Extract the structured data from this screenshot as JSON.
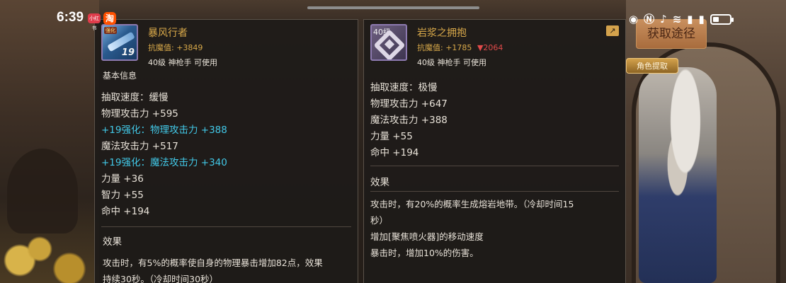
{
  "status_bar": {
    "time": "6:39",
    "badge_small": "小红书",
    "badge_app": "淘",
    "icons": [
      "eye-icon",
      "nfc-icon",
      "mute-icon",
      "wifi-icon",
      "signal-icon",
      "signal-icon-2",
      "battery-icon"
    ]
  },
  "obtain_button": {
    "label": "获取途径"
  },
  "left_item": {
    "name": "暴风行者",
    "icon_level": "19",
    "icon_tag": "强化",
    "magic_resist_label": "抗魔值:",
    "magic_resist_value": "+3849",
    "class_info": "40级 神枪手 可使用",
    "section_title": "基本信息",
    "stats": [
      {
        "text": "抽取速度：缓慢",
        "type": "normal"
      },
      {
        "text": "物理攻击力 +595",
        "type": "normal"
      },
      {
        "text": "+19强化：物理攻击力 +388",
        "type": "enhance"
      },
      {
        "text": "魔法攻击力 +517",
        "type": "normal"
      },
      {
        "text": "+19强化：魔法攻击力 +340",
        "type": "enhance"
      },
      {
        "text": "力量 +36",
        "type": "normal"
      },
      {
        "text": "智力 +55",
        "type": "normal"
      },
      {
        "text": "命中 +194",
        "type": "normal"
      }
    ],
    "effect_title": "效果",
    "effect_lines": [
      "攻击时，有5%的概率使自身的物理暴击增加82点，效果",
      "持续30秒。（冷却时间30秒）"
    ]
  },
  "right_item": {
    "name": "岩浆之拥抱",
    "icon_level": "40级",
    "magic_resist_label": "抗魔值:",
    "magic_resist_value": "+1785",
    "magic_resist_compare": "▼2064",
    "class_info": "40级 神枪手 可使用",
    "share_icon": "share-icon",
    "stats": [
      {
        "text": "抽取速度：极慢",
        "type": "normal"
      },
      {
        "text": "物理攻击力 +647",
        "type": "normal"
      },
      {
        "text": "魔法攻击力 +388",
        "type": "normal"
      },
      {
        "text": "力量 +55",
        "type": "normal"
      },
      {
        "text": "命中 +194",
        "type": "normal"
      }
    ],
    "effect_title": "效果",
    "effect_lines": [
      "攻击时，有20%的概率生成熔岩地带。（冷却时间15",
      "秒）",
      "增加[聚焦喷火器]的移动速度",
      "暴击时，增加10%的伤害。"
    ]
  },
  "background": {
    "side_button": "角色提取"
  },
  "colors": {
    "gold_text": "#d9a94a",
    "enhance_text": "#42c9e8",
    "decrease_text": "#e14a4a",
    "panel_bg": "#1e1b19"
  }
}
